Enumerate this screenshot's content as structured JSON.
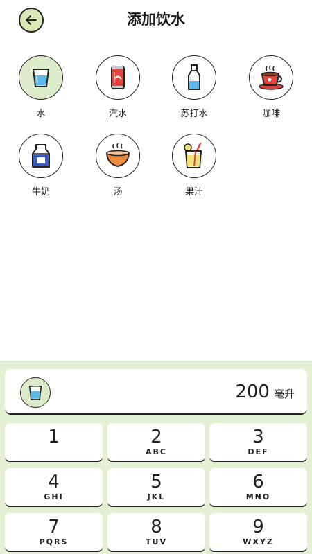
{
  "header": {
    "title": "添加饮水",
    "back_icon": "arrow-left-icon"
  },
  "drinks": [
    {
      "label": "水",
      "icon": "water-glass-icon",
      "selected": true
    },
    {
      "label": "汽水",
      "icon": "soda-can-icon",
      "selected": false
    },
    {
      "label": "苏打水",
      "icon": "soda-water-bottle-icon",
      "selected": false
    },
    {
      "label": "咖啡",
      "icon": "coffee-cup-icon",
      "selected": false
    },
    {
      "label": "牛奶",
      "icon": "milk-carton-icon",
      "selected": false
    },
    {
      "label": "汤",
      "icon": "soup-bowl-icon",
      "selected": false
    },
    {
      "label": "果汁",
      "icon": "juice-glass-icon",
      "selected": false
    }
  ],
  "display": {
    "amount": "200",
    "unit": "毫升",
    "icon": "water-glass-icon"
  },
  "keypad": [
    {
      "digit": "1",
      "letters": ""
    },
    {
      "digit": "2",
      "letters": "ABC"
    },
    {
      "digit": "3",
      "letters": "DEF"
    },
    {
      "digit": "4",
      "letters": "GHI"
    },
    {
      "digit": "5",
      "letters": "JKL"
    },
    {
      "digit": "6",
      "letters": "MNO"
    },
    {
      "digit": "7",
      "letters": "PQRS"
    },
    {
      "digit": "8",
      "letters": "TUV"
    },
    {
      "digit": "9",
      "letters": "WXYZ"
    }
  ],
  "colors": {
    "accent_green": "#dcebc9",
    "panel_bg": "#e4f0d3",
    "water_blue": "#5bb8ea",
    "soda_red": "#e0443a",
    "coffee_brown": "#8a3b2a",
    "soup_orange": "#f08a3a",
    "juice_yellow": "#f6e27a"
  }
}
